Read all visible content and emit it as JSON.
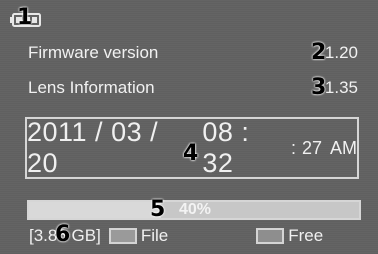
{
  "status": {
    "battery_icon": "battery-icon"
  },
  "info": {
    "firmware_label": "Firmware version",
    "firmware_value": "1.20",
    "lens_label": "Lens Information",
    "lens_value": "1.35"
  },
  "datetime": {
    "date": "2011 / 03 / 20",
    "hour_minute": "08 : 32",
    "seconds": "27",
    "ampm": "AM"
  },
  "storage": {
    "percent_label": "40%",
    "used_fraction": 0.4,
    "total": "[3.86 GB]",
    "file_label": "File",
    "free_label": "Free"
  },
  "callouts": [
    "1",
    "2",
    "3",
    "4",
    "5",
    "6"
  ]
}
